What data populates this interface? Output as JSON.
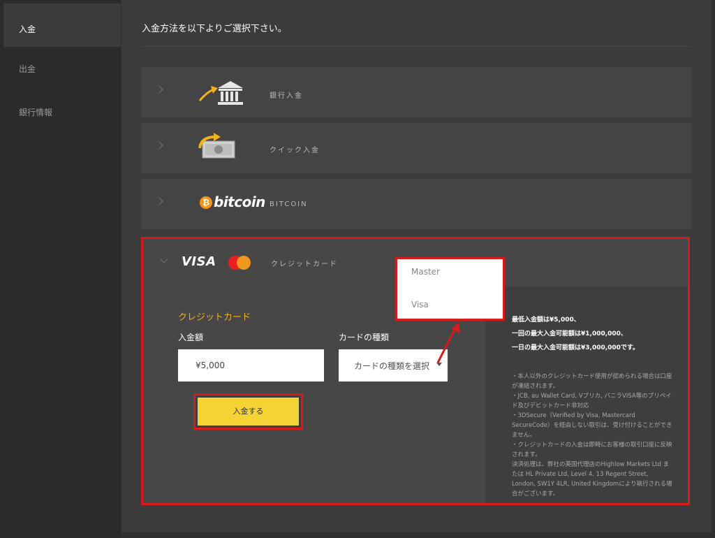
{
  "sidebar": {
    "items": [
      {
        "label": "入金"
      },
      {
        "label": "出金"
      },
      {
        "label": "銀行情報"
      }
    ]
  },
  "page": {
    "title": "入金方法を以下よりご選択下さい。"
  },
  "methods": [
    {
      "label": "銀行入金",
      "icon": "bank-icon"
    },
    {
      "label": "クイック入金",
      "icon": "cash-icon"
    },
    {
      "label": "BITCOIN",
      "logo": "bitcoin"
    }
  ],
  "card": {
    "header_label": "クレジットカード",
    "visa_logo": "VISA",
    "form_title": "クレジットカード",
    "amount_label": "入金額",
    "amount_value": "¥5,000",
    "card_type_label": "カードの種類",
    "card_type_placeholder": "カードの種類を選択",
    "deposit_button": "入金する",
    "info_bold": [
      "最低入金額は¥5,000、",
      "一回の最大入金可能額は¥1,000,000、",
      "一日の最大入金可能額は¥3,000,000です。"
    ],
    "info_text": "・本人以外のクレジットカード使用が認められる場合は口座が凍結されます。\n・JCB, au Wallet Card, Vプリカ, バニラVISA等のプリペイド及びデビットカード非対応\n・3DSecure（Verified by Visa, Mastercard SecureCode）を経由しない取引は、受け付けることができません。\n・クレジットカードの入金は即時にお客様の取引口座に反映されます。\n決済処理は、弊社の英国代理店のHighlow Markets Ltd または HL Private Ltd, Level 4, 13 Regent Street, London, SW1Y 4LR, United Kingdomにより執行される場合がございます。"
  },
  "dropdown": {
    "options": [
      "Master",
      "Visa"
    ]
  },
  "bitcoin_logo_text": "bitcoin",
  "colors": {
    "accent_red": "#d71a1a",
    "button_yellow": "#f4d435",
    "title_gold": "#f2b21a",
    "bitcoin_orange": "#f7931a"
  }
}
